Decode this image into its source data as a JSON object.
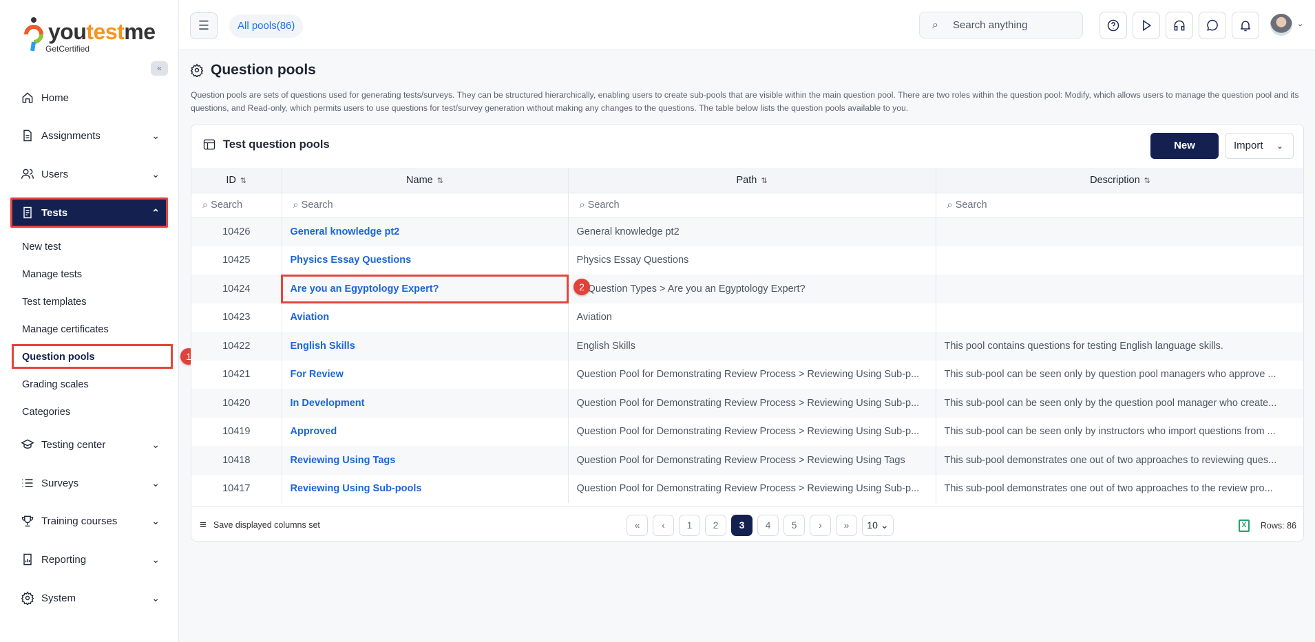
{
  "logo": {
    "text_you": "you",
    "text_test": "test",
    "text_me": "me",
    "tagline": "GetCertified"
  },
  "sidebar": {
    "collapse": "«",
    "items": [
      {
        "label": "Home"
      },
      {
        "label": "Assignments"
      },
      {
        "label": "Users"
      },
      {
        "label": "Tests"
      },
      {
        "label": "Testing center"
      },
      {
        "label": "Surveys"
      },
      {
        "label": "Training courses"
      },
      {
        "label": "Reporting"
      },
      {
        "label": "System"
      }
    ],
    "tests_sub": [
      "New test",
      "Manage tests",
      "Test templates",
      "Manage certificates",
      "Question pools",
      "Grading scales",
      "Categories"
    ]
  },
  "annotations": [
    "1",
    "2"
  ],
  "topbar": {
    "pill": "All pools(86)",
    "search_placeholder": "Search anything"
  },
  "page": {
    "title": "Question pools",
    "description": "Question pools are sets of questions used for generating tests/surveys. They can be structured hierarchically, enabling users to create sub-pools that are visible within the main question pool. There are two roles within the question pool: Modify, which allows users to manage the question pool and its questions, and Read-only, which permits users to use questions for test/survey generation without making any changes to the questions. The table below lists the question pools available to you."
  },
  "card": {
    "title": "Test question pools",
    "new": "New",
    "import": "Import"
  },
  "table": {
    "columns": [
      "ID",
      "Name",
      "Path",
      "Description"
    ],
    "search_placeholder": "Search",
    "rows": [
      [
        "10426",
        "General knowledge pt2",
        "General knowledge pt2",
        ""
      ],
      [
        "10425",
        "Physics Essay Questions",
        "Physics Essay Questions",
        ""
      ],
      [
        "10424",
        "Are you an Egyptology Expert?",
        "Question Types > Are you an Egyptology Expert?",
        ""
      ],
      [
        "10423",
        "Aviation",
        "Aviation",
        ""
      ],
      [
        "10422",
        "English Skills",
        "English Skills",
        "This pool contains questions for testing English language skills."
      ],
      [
        "10421",
        "For Review",
        "Question Pool for Demonstrating Review Process > Reviewing Using Sub-p...",
        "This sub-pool can be seen only by question pool managers who approve ..."
      ],
      [
        "10420",
        "In Development",
        "Question Pool for Demonstrating Review Process > Reviewing Using Sub-p...",
        "This sub-pool can be seen only by the question pool manager who create..."
      ],
      [
        "10419",
        "Approved",
        "Question Pool for Demonstrating Review Process > Reviewing Using Sub-p...",
        "This sub-pool can be seen only by instructors who import questions from ..."
      ],
      [
        "10418",
        "Reviewing Using Tags",
        "Question Pool for Demonstrating Review Process > Reviewing Using Tags",
        "This sub-pool demonstrates one out of two approaches to reviewing ques..."
      ],
      [
        "10417",
        "Reviewing Using Sub-pools",
        "Question Pool for Demonstrating Review Process > Reviewing Using Sub-p...",
        "This sub-pool demonstrates one out of two approaches to the review pro..."
      ]
    ]
  },
  "footer": {
    "save": "Save displayed columns set",
    "pages": [
      "«",
      "‹",
      "1",
      "2",
      "3",
      "4",
      "5",
      "›",
      "»"
    ],
    "current_page": "3",
    "page_size": "10",
    "rows": "Rows: 86"
  }
}
